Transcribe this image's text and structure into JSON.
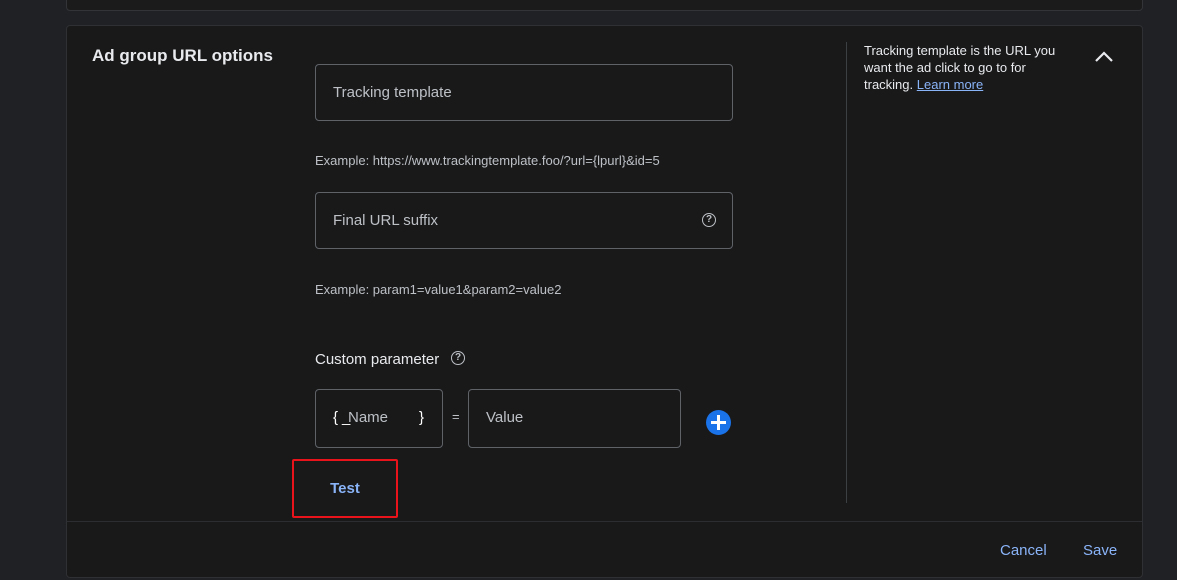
{
  "section": {
    "title": "Ad group URL options"
  },
  "tracking_template": {
    "placeholder": "Tracking template",
    "example": "Example: https://www.trackingtemplate.foo/?url={lpurl}&id=5"
  },
  "final_url_suffix": {
    "placeholder": "Final URL suffix",
    "help_icon": "help-circle-icon",
    "example": "Example: param1=value1&param2=value2"
  },
  "custom_parameter": {
    "label": "Custom parameter",
    "help_icon": "help-circle-icon",
    "brace_open": "{",
    "underscore": "_",
    "name_placeholder": "Name",
    "brace_close": "}",
    "equals": "=",
    "value_placeholder": "Value",
    "add_icon": "add-circle-icon"
  },
  "test_button": {
    "label": "Test",
    "highlight_color": "#e8131b"
  },
  "help_panel": {
    "text": "Tracking template is the URL you want the ad click to go to for tracking.",
    "link": "Learn more"
  },
  "footer": {
    "cancel_label": "Cancel",
    "save_label": "Save"
  },
  "colors": {
    "background": "#202124",
    "card": "#19191a",
    "accent": "#8ab4f8",
    "add_button": "#1a73e8",
    "border": "#5f6368"
  }
}
